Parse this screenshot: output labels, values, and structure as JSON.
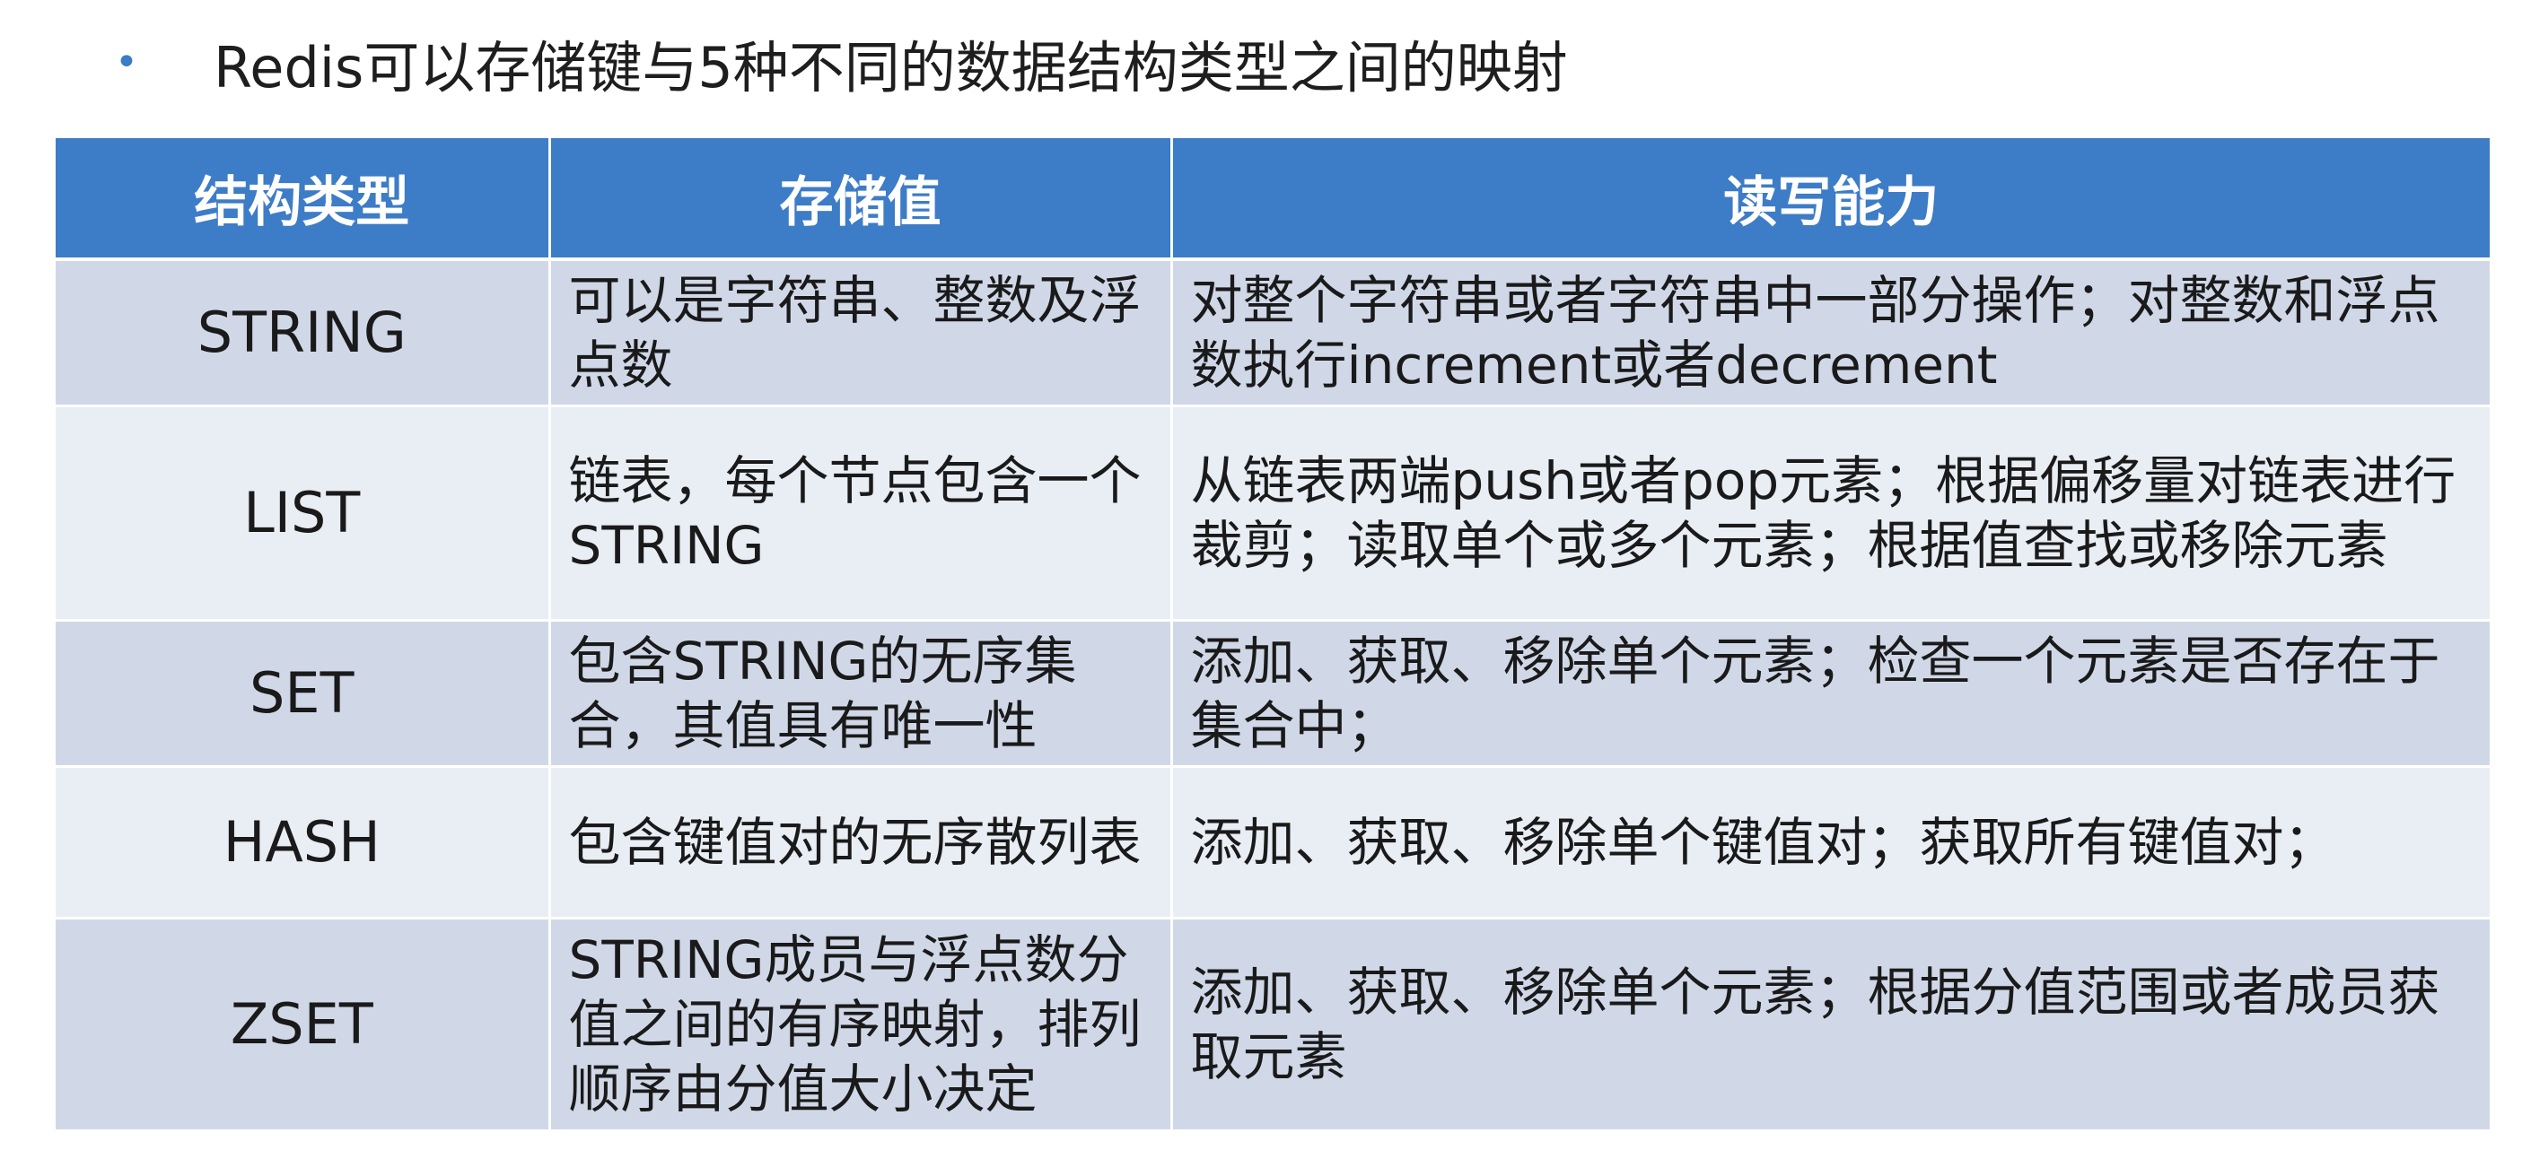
{
  "heading": {
    "bullet": "•",
    "text": "Redis可以存储键与5种不同的数据结构类型之间的映射"
  },
  "table": {
    "headers": [
      "结构类型",
      "存储值",
      "读写能力"
    ],
    "rows": [
      {
        "type": "STRING",
        "value": "可以是字符串、整数及浮点数",
        "ability": "对整个字符串或者字符串中一部分操作；对整数和浮点数执行increment或者decrement"
      },
      {
        "type": "LIST",
        "value": "链表，每个节点包含一个STRING",
        "ability": "从链表两端push或者pop元素；根据偏移量对链表进行裁剪；读取单个或多个元素；根据值查找或移除元素"
      },
      {
        "type": "SET",
        "value": "包含STRING的无序集合，其值具有唯一性",
        "ability": "添加、获取、移除单个元素；检查一个元素是否存在于集合中；"
      },
      {
        "type": "HASH",
        "value": "包含键值对的无序散列表",
        "ability": "添加、获取、移除单个键值对；获取所有键值对；"
      },
      {
        "type": "ZSET",
        "value": "STRING成员与浮点数分值之间的有序映射，排列顺序由分值大小决定",
        "ability": "添加、获取、移除单个元素；根据分值范围或者成员获取元素"
      }
    ]
  },
  "colors": {
    "header_bg": "#3d7cc7",
    "row_odd_bg": "#d0d8e8",
    "row_even_bg": "#e9edf4",
    "bullet": "#3a7cc5"
  }
}
